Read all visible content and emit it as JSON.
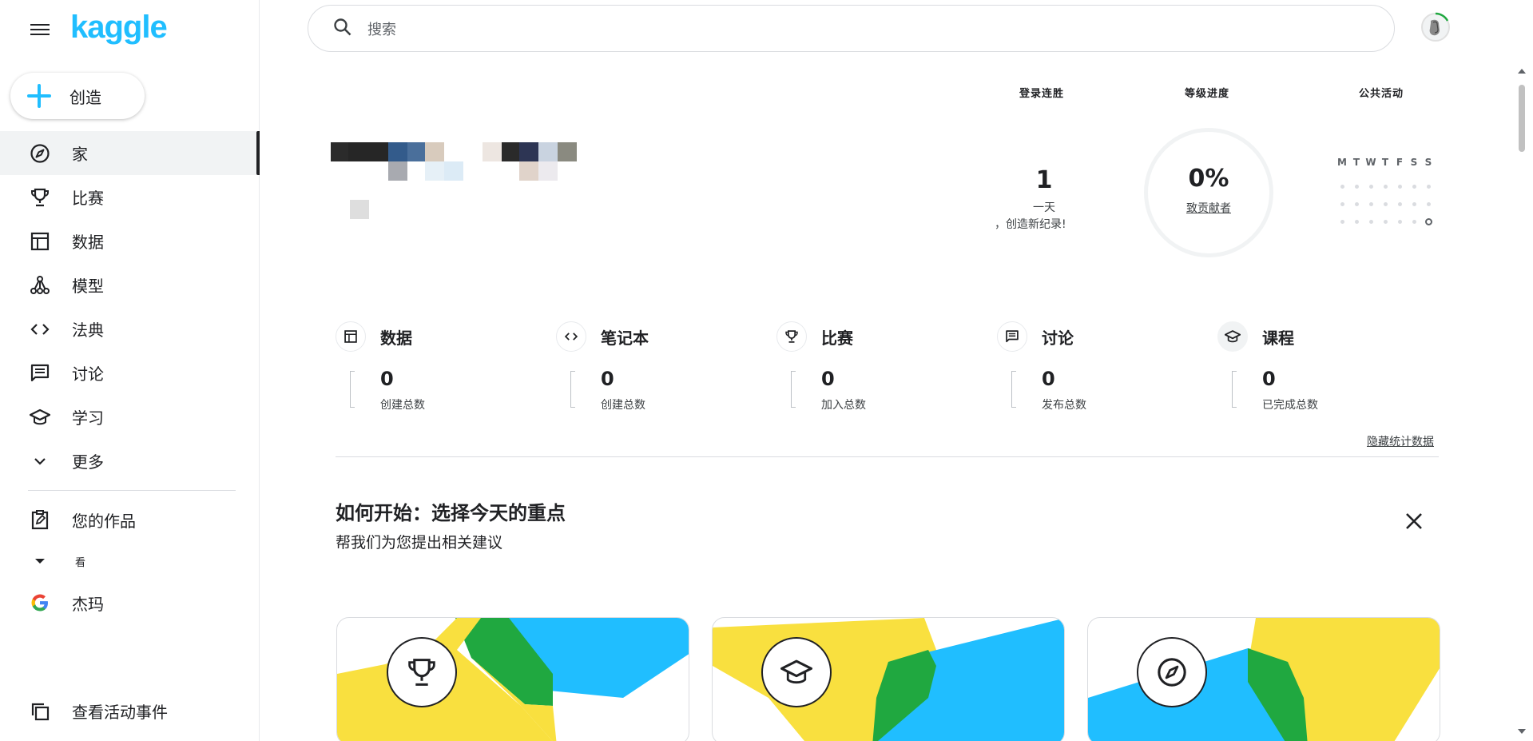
{
  "app": {
    "logo": "kaggle"
  },
  "sidebar": {
    "create_label": "创造",
    "items": [
      {
        "label": "家",
        "icon": "compass-icon",
        "active": true
      },
      {
        "label": "比赛",
        "icon": "trophy-icon"
      },
      {
        "label": "数据",
        "icon": "table-icon"
      },
      {
        "label": "模型",
        "icon": "model-icon"
      },
      {
        "label": "法典",
        "icon": "code-icon"
      },
      {
        "label": "讨论",
        "icon": "comment-icon"
      },
      {
        "label": "学习",
        "icon": "school-icon"
      },
      {
        "label": "更多",
        "icon": "chevron-down-icon"
      }
    ],
    "your_work": "您的作品",
    "view_label": "看",
    "google_label": "杰玛",
    "activity_label": "查看活动事件"
  },
  "search": {
    "placeholder": "搜索"
  },
  "profile": {
    "streak_header": "登录连胜",
    "streak_value": "1",
    "streak_unit": "一天",
    "streak_note": "，创造新纪录!",
    "level_header": "等级进度",
    "level_percent": "0%",
    "level_label": "致贡献者",
    "activity_header": "公共活动",
    "days": [
      "M",
      "T",
      "W",
      "T",
      "F",
      "S",
      "S"
    ]
  },
  "stats": [
    {
      "title": "数据",
      "value": "0",
      "sub": "创建总数",
      "icon": "table-icon"
    },
    {
      "title": "笔记本",
      "value": "0",
      "sub": "创建总数",
      "icon": "code-icon"
    },
    {
      "title": "比赛",
      "value": "0",
      "sub": "加入总数",
      "icon": "trophy-icon"
    },
    {
      "title": "讨论",
      "value": "0",
      "sub": "发布总数",
      "icon": "comment-icon"
    },
    {
      "title": "课程",
      "value": "0",
      "sub": "已完成总数",
      "icon": "school-icon"
    }
  ],
  "hide_stats": "隐藏统计数据",
  "getting_started": {
    "title": "如何开始：选择今天的重点",
    "subtitle": "帮我们为您提出相关建议"
  },
  "colors": {
    "brand": "#20beff",
    "yellow": "#f9e03f",
    "green": "#20a840",
    "blue": "#20beff"
  }
}
